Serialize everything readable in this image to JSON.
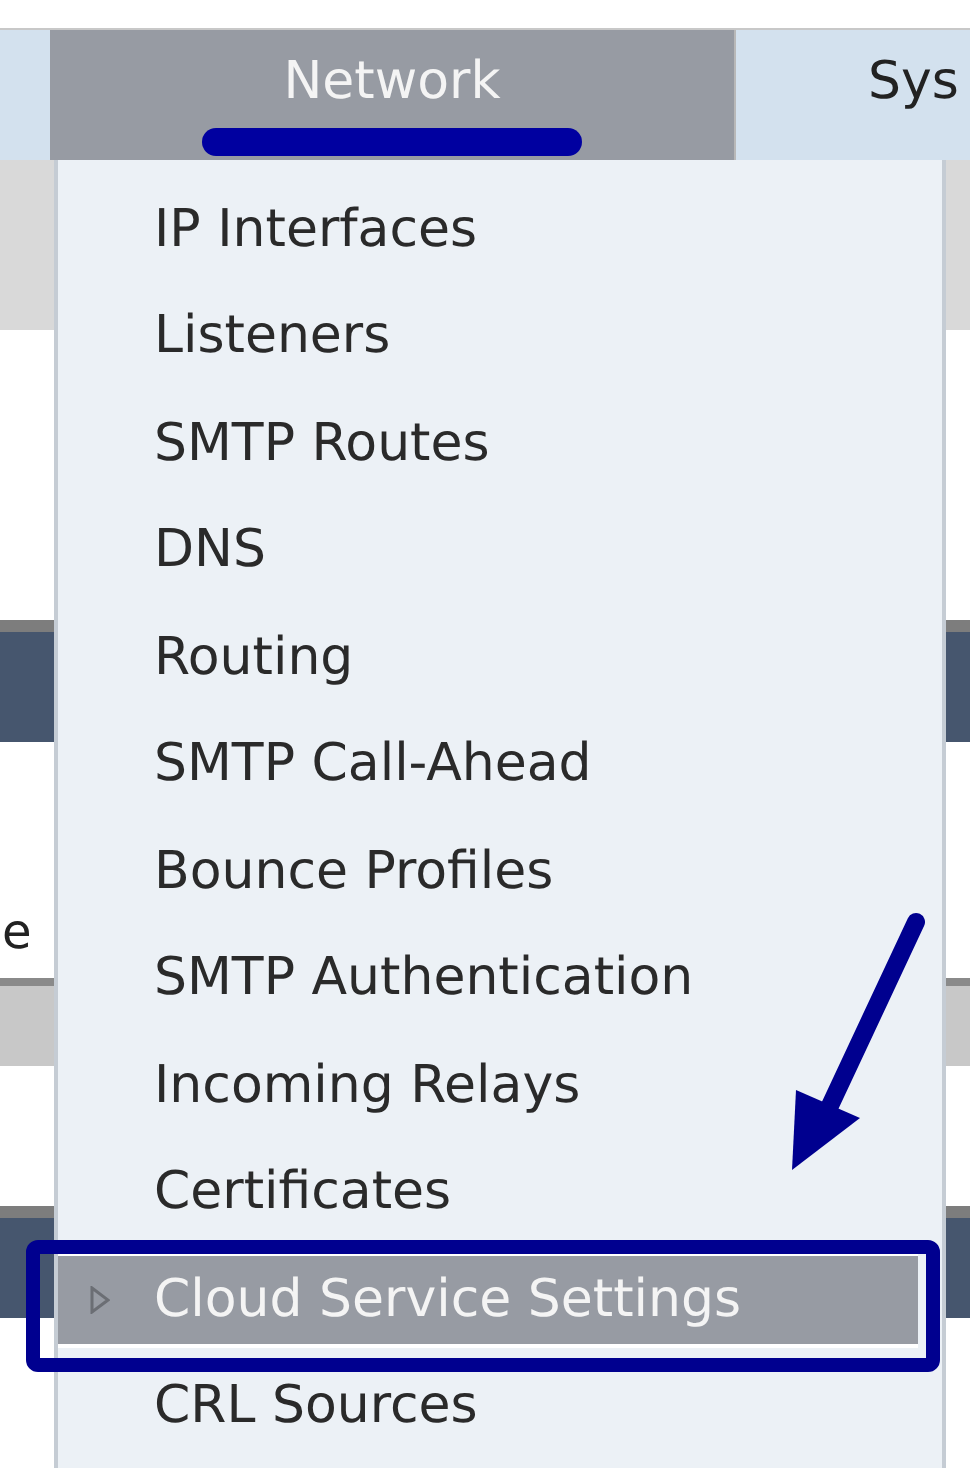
{
  "tabs": [
    {
      "label": "Network",
      "selected": true
    },
    {
      "label": "Sys",
      "selected": false
    }
  ],
  "background_text": "e",
  "menu": {
    "items": [
      {
        "label": "IP Interfaces",
        "selected": false
      },
      {
        "label": "Listeners",
        "selected": false
      },
      {
        "label": "SMTP Routes",
        "selected": false
      },
      {
        "label": "DNS",
        "selected": false
      },
      {
        "label": "Routing",
        "selected": false
      },
      {
        "label": "SMTP Call-Ahead",
        "selected": false
      },
      {
        "label": "Bounce Profiles",
        "selected": false
      },
      {
        "label": "SMTP Authentication",
        "selected": false
      },
      {
        "label": "Incoming Relays",
        "selected": false
      },
      {
        "label": "Certificates",
        "selected": false
      },
      {
        "label": "Cloud Service Settings",
        "selected": true
      },
      {
        "label": "CRL Sources",
        "selected": false
      }
    ]
  }
}
